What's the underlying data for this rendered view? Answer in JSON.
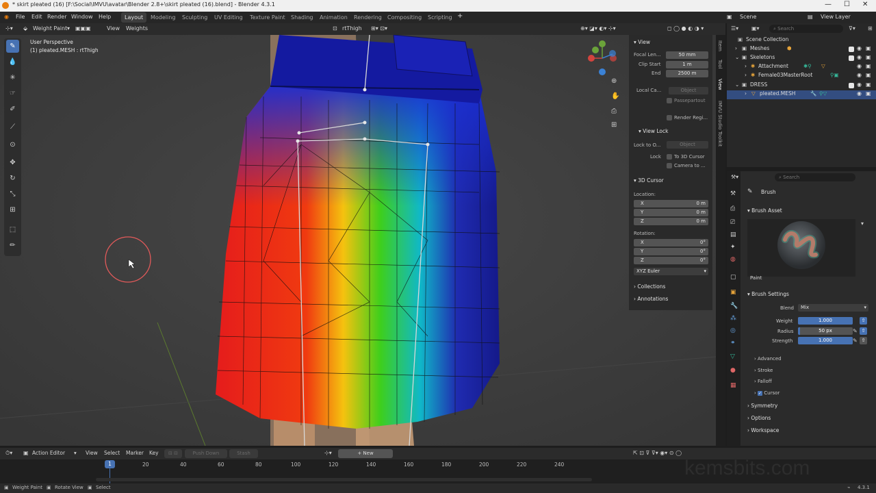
{
  "titlebar": {
    "title": "* skirt pleated (16) [F:\\Social\\IMVU\\avatar\\Blender 2.8+\\skirt pleated (16).blend] - Blender 4.3.1"
  },
  "menu": {
    "items": [
      "File",
      "Edit",
      "Render",
      "Window",
      "Help"
    ]
  },
  "workspaces": [
    "Layout",
    "Modeling",
    "Sculpting",
    "UV Editing",
    "Texture Paint",
    "Shading",
    "Animation",
    "Rendering",
    "Compositing",
    "Scripting"
  ],
  "topright": {
    "scene": "Scene",
    "view_layer": "View Layer"
  },
  "vp_header": {
    "mode": "Weight Paint",
    "view": "View",
    "weights": "Weights",
    "vgroup": "rtThigh"
  },
  "viewport": {
    "perspective": "User Perspective",
    "object": "(1) pleated.MESH : rtThigh"
  },
  "npanel": {
    "view_title": "View",
    "focal_label": "Focal Len...",
    "focal": "50 mm",
    "clip_start_label": "Clip Start",
    "clip_start": "1 m",
    "end_label": "End",
    "end": "2500 m",
    "local_cam_label": "Local Ca...",
    "local_cam_placeholder": "Object",
    "passepartout": "Passepartout",
    "render_region": "Render Regi...",
    "view_lock_title": "View Lock",
    "lock_to_label": "Lock to O...",
    "lock_to_placeholder": "Object",
    "lock_label": "Lock",
    "lock_cursor": "To 3D Cursor",
    "lock_camera": "Camera to ...",
    "cursor_title": "3D Cursor",
    "location": "Location:",
    "rotation": "Rotation:",
    "x": "X",
    "y": "Y",
    "z": "Z",
    "loc_x": "0 m",
    "loc_y": "0 m",
    "loc_z": "0 m",
    "rot_x": "0°",
    "rot_y": "0°",
    "rot_z": "0°",
    "rot_mode": "XYZ Euler",
    "collections": "Collections",
    "annotations": "Annotations"
  },
  "ntabs": [
    "Item",
    "Tool",
    "View",
    "IMVU Studio Toolkit"
  ],
  "outliner": {
    "search": "Search",
    "rows": [
      {
        "label": "Scene Collection"
      },
      {
        "label": "Meshes"
      },
      {
        "label": "Skeletons"
      },
      {
        "label": "Attachment"
      },
      {
        "label": "Female03MasterRoot"
      },
      {
        "label": "DRESS"
      },
      {
        "label": "pleated.MESH"
      }
    ]
  },
  "props": {
    "search": "Search",
    "brush_title": "Brush",
    "brush_asset": "Brush Asset",
    "brush_name": "Paint",
    "brush_settings": "Brush Settings",
    "blend_label": "Blend",
    "blend": "Mix",
    "weight_label": "Weight",
    "weight": "1.000",
    "weight_fill": 1.0,
    "radius_label": "Radius",
    "radius": "50 px",
    "strength_label": "Strength",
    "strength": "1.000",
    "strength_fill": 1.0,
    "advanced": "Advanced",
    "stroke": "Stroke",
    "falloff": "Falloff",
    "cursor": "Cursor",
    "symmetry": "Symmetry",
    "options": "Options",
    "workspace": "Workspace"
  },
  "timeline": {
    "editor": "Action Editor",
    "view": "View",
    "select": "Select",
    "marker": "Marker",
    "key": "Key",
    "push_down": "Push Down",
    "stash": "Stash",
    "new": "New",
    "frame": "1",
    "ticks": [
      "20",
      "40",
      "60",
      "80",
      "100",
      "120",
      "140",
      "160",
      "180",
      "200",
      "220",
      "240"
    ]
  },
  "status": {
    "a": "Weight Paint",
    "b": "Rotate View",
    "c": "Select",
    "version": "4.3.1"
  },
  "watermark": "kemsbits.com"
}
